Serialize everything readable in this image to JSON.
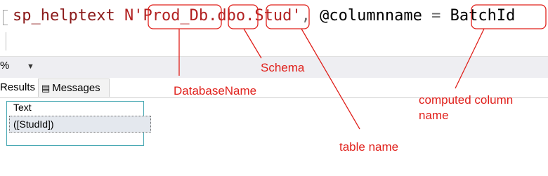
{
  "editor": {
    "command": "sp_helptext",
    "n_prefix": "N",
    "quote_open": "'",
    "database": "Prod_Db",
    "dot1": ".",
    "schema": "dbo",
    "dot2": ".",
    "table": "Stud",
    "quote_close": "'",
    "comma": ",",
    "param": "@columnname",
    "equals": "=",
    "column": "BatchId"
  },
  "toolbar": {
    "zoom": "%"
  },
  "tabs": [
    {
      "label": "Results"
    },
    {
      "label": "Messages"
    }
  ],
  "grid": {
    "header": "Text",
    "rows": [
      "([StudId])"
    ]
  },
  "annotations": {
    "schema": "Schema",
    "database_name": "DatabaseName",
    "computed_column": "computed column name",
    "table_name": "table name",
    "color": "#e0201b"
  }
}
